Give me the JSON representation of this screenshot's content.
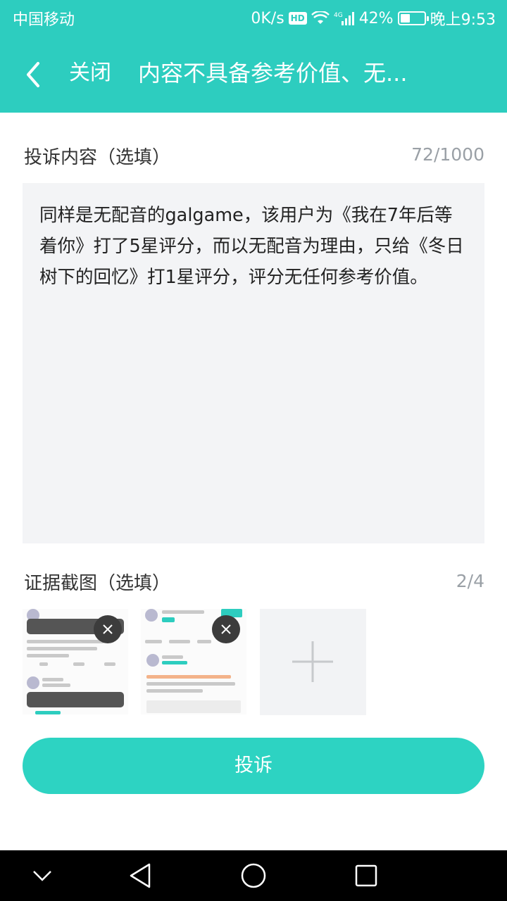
{
  "status_bar": {
    "carrier": "中国移动",
    "network_speed": "0K/s",
    "hd": "HD",
    "signal": "4G",
    "battery_percent": "42%",
    "battery_level": 0.42,
    "time": "晚上9:53"
  },
  "header": {
    "back_icon": "chevron-left-icon",
    "close_label": "关闭",
    "title": "内容不具备参考价值、无..."
  },
  "complaint": {
    "label": "投诉内容（选填）",
    "counter": "72/1000",
    "text": "同样是无配音的galgame，该用户为《我在7年后等着你》打了5星评分，而以无配音为理由，只给《冬日树下的回忆》打1星评分，评分无任何参考价值。"
  },
  "evidence": {
    "label": "证据截图（选填）",
    "counter": "2/4",
    "screenshots": [
      {
        "name": "evidence-screenshot-1",
        "remove_icon": "close-icon"
      },
      {
        "name": "evidence-screenshot-2",
        "remove_icon": "close-icon"
      }
    ],
    "add_icon": "plus-icon"
  },
  "submit_label": "投诉",
  "nav": {
    "items": [
      "chevron-down-icon",
      "back-triangle-icon",
      "home-circle-icon",
      "recent-square-icon"
    ]
  },
  "colors": {
    "accent": "#2dcdbf",
    "button": "#2dd3c2",
    "textarea_bg": "#f3f4f6",
    "muted": "#9aa0a6"
  }
}
